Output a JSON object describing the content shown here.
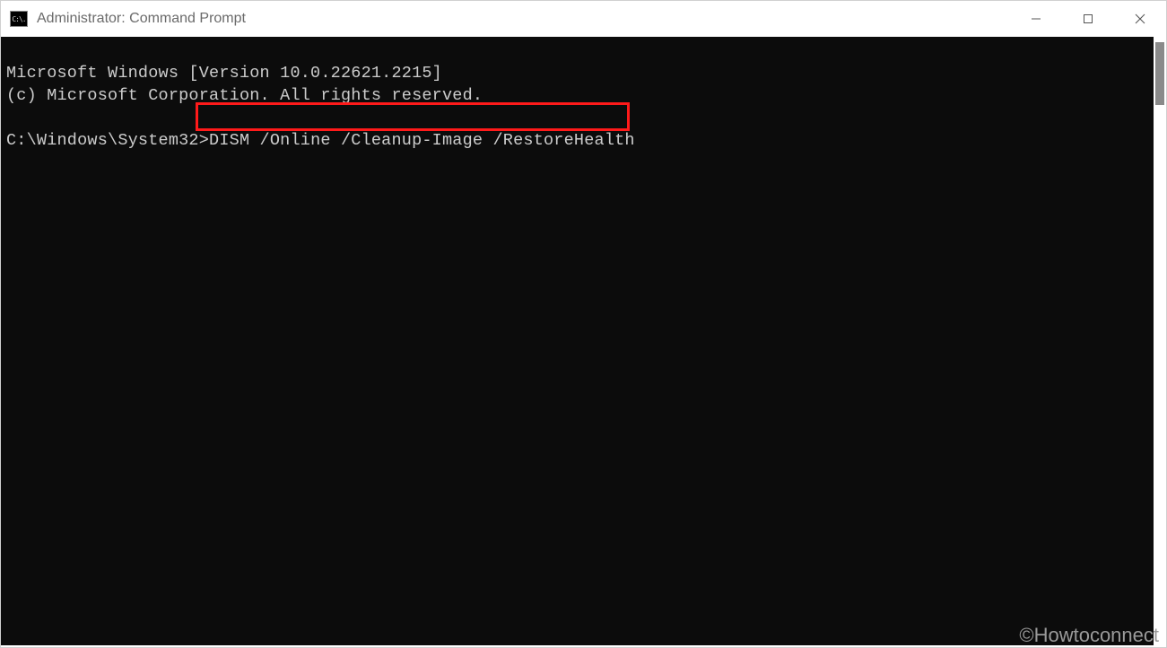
{
  "window": {
    "title": "Administrator: Command Prompt",
    "icon_label": "C:\\."
  },
  "terminal": {
    "line1": "Microsoft Windows [Version 10.0.22621.2215]",
    "line2": "(c) Microsoft Corporation. All rights reserved.",
    "prompt": "C:\\Windows\\System32>",
    "command": "DISM /Online /Cleanup-Image /RestoreHealth"
  },
  "watermark": "©Howtoconnect"
}
